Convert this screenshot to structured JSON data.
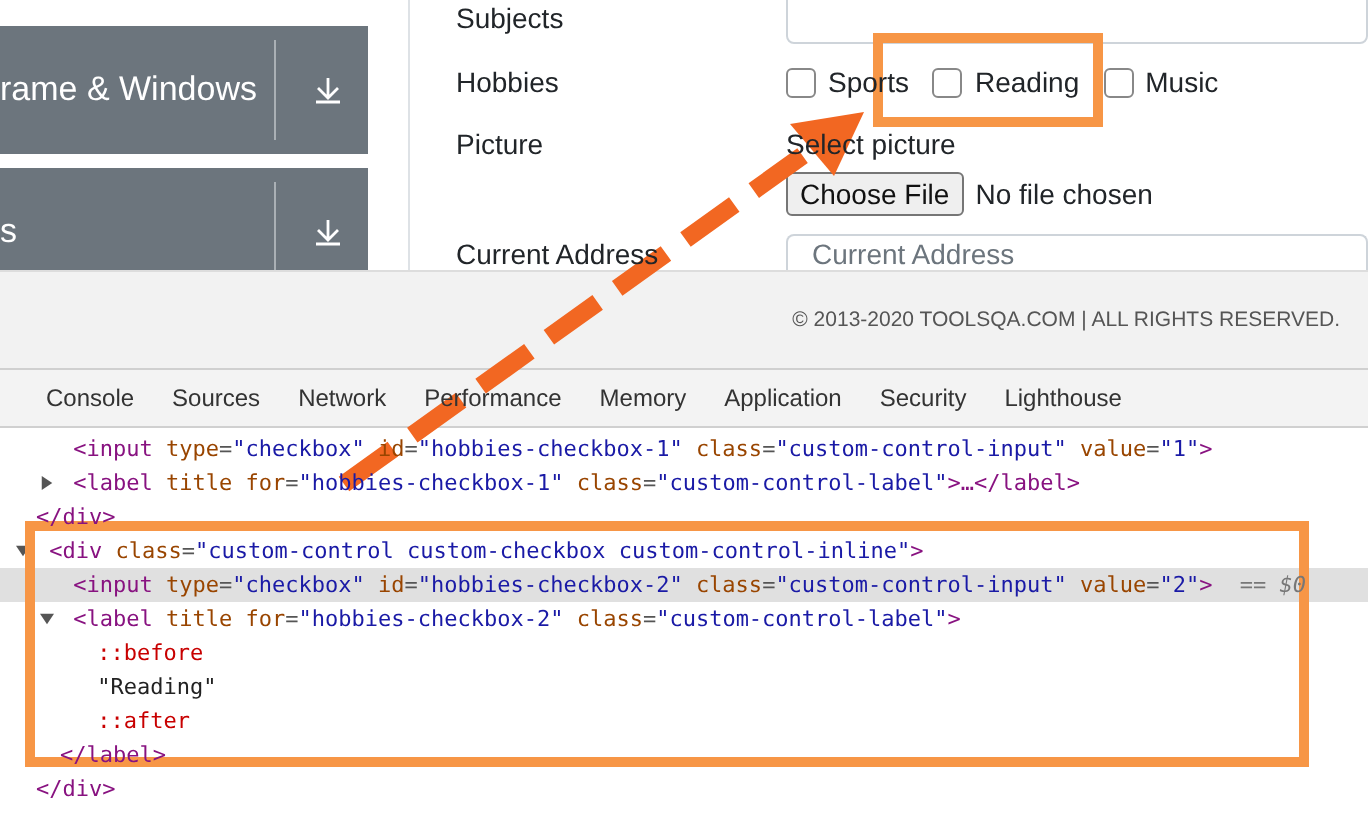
{
  "sidebar": {
    "items": [
      {
        "label": "rame & Windows"
      },
      {
        "label": "s"
      }
    ]
  },
  "form": {
    "subjects": {
      "label": "Subjects"
    },
    "hobbies": {
      "label": "Hobbies",
      "options": [
        {
          "label": "Sports",
          "checked": false
        },
        {
          "label": "Reading",
          "checked": false
        },
        {
          "label": "Music",
          "checked": false
        }
      ]
    },
    "picture": {
      "label": "Picture",
      "hint": "Select picture",
      "button": "Choose File",
      "status": "No file chosen"
    },
    "current_address": {
      "label": "Current Address",
      "placeholder": "Current Address"
    }
  },
  "footer": {
    "copyright": "© 2013-2020 TOOLSQA.COM | ALL RIGHTS RESERVED."
  },
  "devtools": {
    "tabs": [
      "Console",
      "Sources",
      "Network",
      "Performance",
      "Memory",
      "Application",
      "Security",
      "Lighthouse"
    ],
    "dom_tree": [
      {
        "kind": "element",
        "children": [
          {
            "kind": "element",
            "open": "<input type=\"checkbox\" id=\"hobbies-checkbox-1\" class=\"custom-control-input\" value=\"1\">",
            "selected": false
          },
          {
            "kind": "element",
            "open": "<label title for=\"hobbies-checkbox-1\" class=\"custom-control-label\">…</label>",
            "expanded": false,
            "selected": false
          }
        ],
        "close": "</div>"
      },
      {
        "kind": "element",
        "open": "<div class=\"custom-control custom-checkbox custom-control-inline\">",
        "expanded": true,
        "selected": false,
        "children": [
          {
            "kind": "element",
            "open": "<input type=\"checkbox\" id=\"hobbies-checkbox-2\" class=\"custom-control-input\" value=\"2\">",
            "selected": true,
            "suffix": "== $0"
          },
          {
            "kind": "element",
            "open": "<label title for=\"hobbies-checkbox-2\" class=\"custom-control-label\">",
            "expanded": true,
            "selected": false,
            "children": [
              {
                "kind": "pseudo",
                "open": "::before"
              },
              {
                "kind": "text",
                "open": "\"Reading\""
              },
              {
                "kind": "pseudo",
                "open": "::after"
              }
            ],
            "close": "</label>"
          }
        ],
        "close": "</div>"
      }
    ]
  }
}
